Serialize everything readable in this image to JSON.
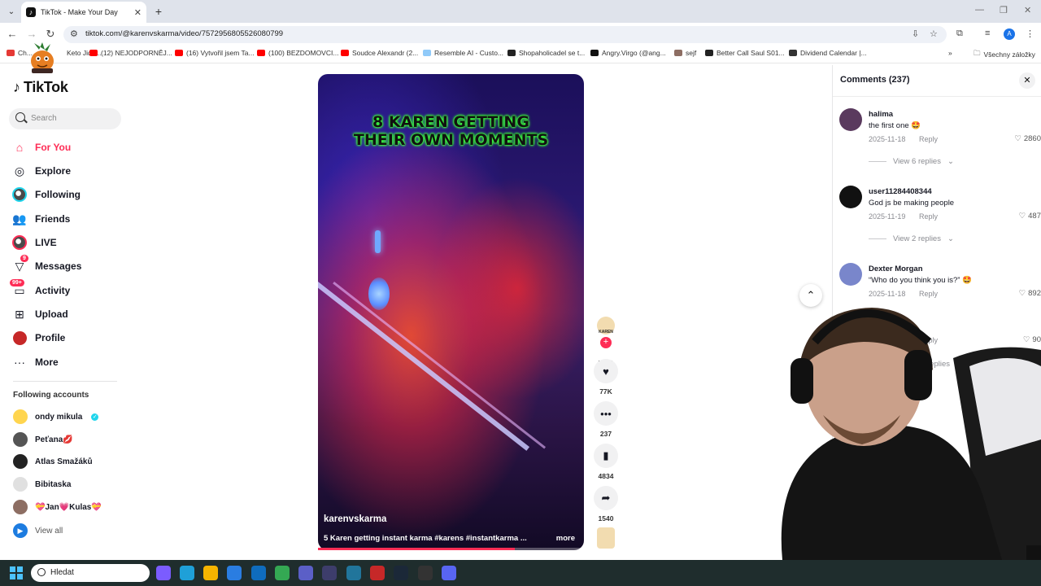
{
  "browser": {
    "tab_title": "TikTok - Make Your Day",
    "url": "tiktok.com/@karenvskarma/video/7572956805526080799",
    "profile_initial": "A",
    "bookmarks": [
      {
        "label": "Ch...",
        "color": "#e53935"
      },
      {
        "label": "Keto Jide...",
        "color": "#ffffff"
      },
      {
        "label": "(12) NEJODPORNĚJ...",
        "color": "#ff0000"
      },
      {
        "label": "(16) Vytvořil jsem Ta...",
        "color": "#ff0000"
      },
      {
        "label": "(100) BEZDOMOVCI...",
        "color": "#ff0000"
      },
      {
        "label": "Soudce Alexandr (2...",
        "color": "#ff0000"
      },
      {
        "label": "Resemble AI - Custo...",
        "color": "#90caf9"
      },
      {
        "label": "Shopaholicadel se t...",
        "color": "#222222"
      },
      {
        "label": "Angry.Virgo (@ang...",
        "color": "#111111"
      },
      {
        "label": "sejf",
        "color": "#8d6e63"
      },
      {
        "label": "Better Call Saul S01...",
        "color": "#222222"
      },
      {
        "label": "Dividend Calendar |...",
        "color": "#333333"
      }
    ],
    "bookmarks_folder": "Všechny záložky"
  },
  "sidebar": {
    "logo": "TikTok",
    "search_placeholder": "Search",
    "nav": [
      {
        "label": "For You",
        "icon": "home-icon"
      },
      {
        "label": "Explore",
        "icon": "compass-icon"
      },
      {
        "label": "Following",
        "icon": "following-avatar-icon"
      },
      {
        "label": "Friends",
        "icon": "friends-icon"
      },
      {
        "label": "LIVE",
        "icon": "live-icon"
      },
      {
        "label": "Messages",
        "icon": "messages-icon",
        "badge": "9"
      },
      {
        "label": "Activity",
        "icon": "activity-icon",
        "badge": "99+"
      },
      {
        "label": "Upload",
        "icon": "upload-icon"
      },
      {
        "label": "Profile",
        "icon": "profile-icon"
      },
      {
        "label": "More",
        "icon": "more-icon"
      }
    ],
    "following_heading": "Following accounts",
    "following": [
      {
        "name": "ondy mikula",
        "verified": true,
        "avatar": "#ffd54f"
      },
      {
        "name": "Peťana💋",
        "verified": false,
        "avatar": "#555555"
      },
      {
        "name": "Atlas Smažáků",
        "verified": false,
        "avatar": "#222222"
      },
      {
        "name": "Bibitaska",
        "verified": false,
        "avatar": "#e0e0e0"
      },
      {
        "name": "💝Jan💗Kulas💝",
        "verified": false,
        "avatar": "#8d6e63"
      }
    ],
    "view_all": "View all"
  },
  "video": {
    "overlay_line1": "8 KAREN GETTING",
    "overlay_line2": "THEIR OWN MOMENTS",
    "author": "karenvskarma",
    "description": "5 Karen getting instant karma #karens #instantkarma ...",
    "more": "more",
    "progress_pct": 74
  },
  "actions": {
    "creator_tag": "KAREN KARMA",
    "likes": "77K",
    "comments": "237",
    "saves": "4834",
    "shares": "1540"
  },
  "comments": {
    "header": "Comments (237)",
    "reply_label": "Reply",
    "items": [
      {
        "user": "halima",
        "text": "the first one 🤩",
        "date": "2025-11-18",
        "likes": "2860",
        "view_replies": "View 6 replies",
        "avatar": "#5a3a5e"
      },
      {
        "user": "user11284408344",
        "text": "God js be making people",
        "date": "2025-11-19",
        "likes": "487",
        "view_replies": "View 2 replies",
        "avatar": "#111111"
      },
      {
        "user": "Dexter Morgan",
        "text": "“Who do you think you is?” 🤩",
        "date": "2025-11-18",
        "likes": "892",
        "avatar": "#7986cb"
      }
    ],
    "partial_likes": "90",
    "partial_view_replies": "replies"
  },
  "taskbar": {
    "search_placeholder": "Hledat"
  }
}
